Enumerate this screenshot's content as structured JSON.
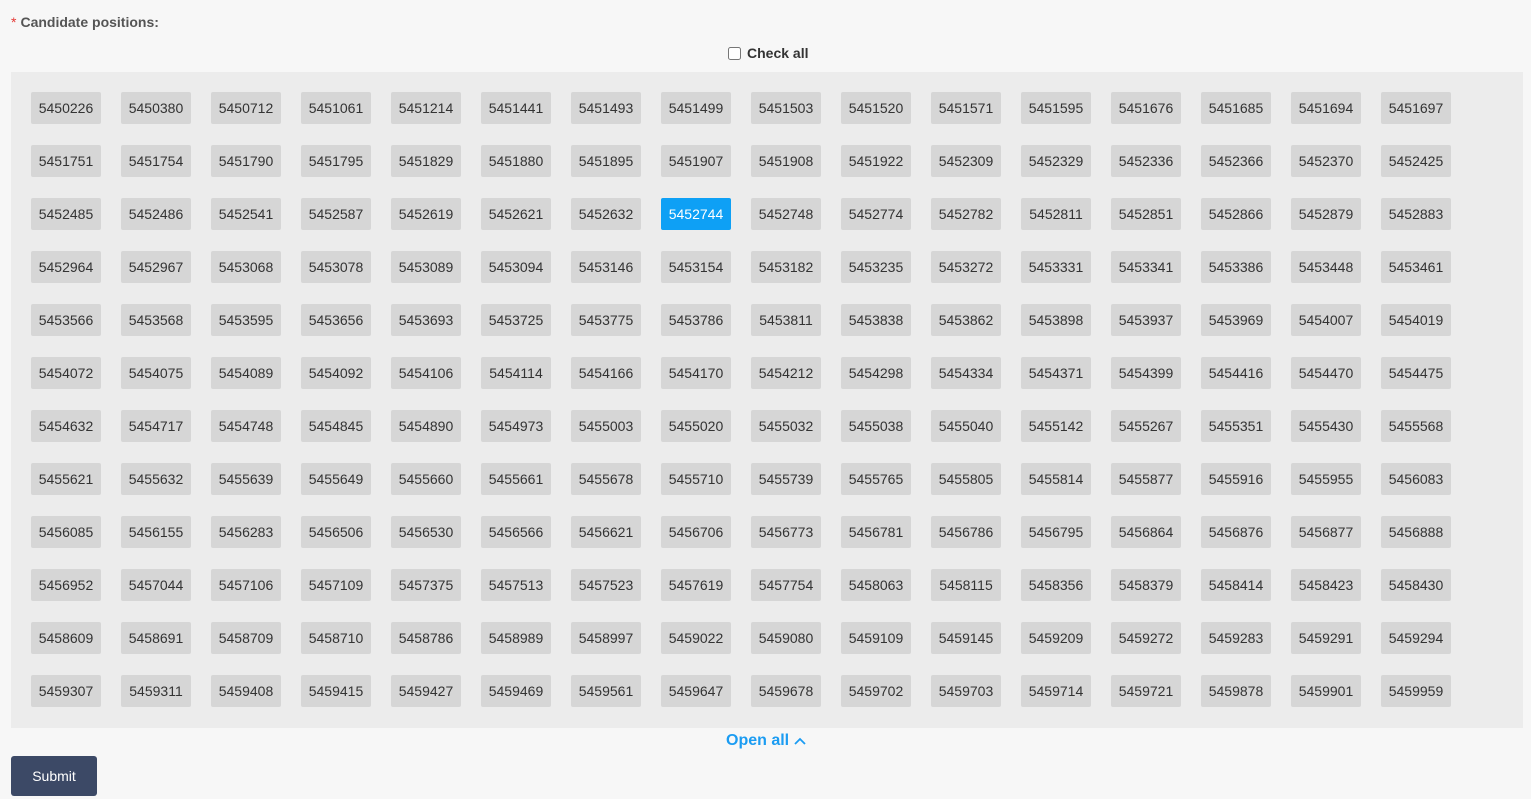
{
  "form": {
    "required_mark": "*",
    "label": "Candidate positions:",
    "check_all_label": "Check all",
    "open_all_label": "Open all",
    "submit_label": "Submit",
    "selected": "5452744",
    "positions": [
      "5450226",
      "5450380",
      "5450712",
      "5451061",
      "5451214",
      "5451441",
      "5451493",
      "5451499",
      "5451503",
      "5451520",
      "5451571",
      "5451595",
      "5451676",
      "5451685",
      "5451694",
      "5451697",
      "5451751",
      "5451754",
      "5451790",
      "5451795",
      "5451829",
      "5451880",
      "5451895",
      "5451907",
      "5451908",
      "5451922",
      "5452309",
      "5452329",
      "5452336",
      "5452366",
      "5452370",
      "5452425",
      "5452485",
      "5452486",
      "5452541",
      "5452587",
      "5452619",
      "5452621",
      "5452632",
      "5452744",
      "5452748",
      "5452774",
      "5452782",
      "5452811",
      "5452851",
      "5452866",
      "5452879",
      "5452883",
      "5452964",
      "5452967",
      "5453068",
      "5453078",
      "5453089",
      "5453094",
      "5453146",
      "5453154",
      "5453182",
      "5453235",
      "5453272",
      "5453331",
      "5453341",
      "5453386",
      "5453448",
      "5453461",
      "5453566",
      "5453568",
      "5453595",
      "5453656",
      "5453693",
      "5453725",
      "5453775",
      "5453786",
      "5453811",
      "5453838",
      "5453862",
      "5453898",
      "5453937",
      "5453969",
      "5454007",
      "5454019",
      "5454072",
      "5454075",
      "5454089",
      "5454092",
      "5454106",
      "5454114",
      "5454166",
      "5454170",
      "5454212",
      "5454298",
      "5454334",
      "5454371",
      "5454399",
      "5454416",
      "5454470",
      "5454475",
      "5454632",
      "5454717",
      "5454748",
      "5454845",
      "5454890",
      "5454973",
      "5455003",
      "5455020",
      "5455032",
      "5455038",
      "5455040",
      "5455142",
      "5455267",
      "5455351",
      "5455430",
      "5455568",
      "5455621",
      "5455632",
      "5455639",
      "5455649",
      "5455660",
      "5455661",
      "5455678",
      "5455710",
      "5455739",
      "5455765",
      "5455805",
      "5455814",
      "5455877",
      "5455916",
      "5455955",
      "5456083",
      "5456085",
      "5456155",
      "5456283",
      "5456506",
      "5456530",
      "5456566",
      "5456621",
      "5456706",
      "5456773",
      "5456781",
      "5456786",
      "5456795",
      "5456864",
      "5456876",
      "5456877",
      "5456888",
      "5456952",
      "5457044",
      "5457106",
      "5457109",
      "5457375",
      "5457513",
      "5457523",
      "5457619",
      "5457754",
      "5458063",
      "5458115",
      "5458356",
      "5458379",
      "5458414",
      "5458423",
      "5458430",
      "5458609",
      "5458691",
      "5458709",
      "5458710",
      "5458786",
      "5458989",
      "5458997",
      "5459022",
      "5459080",
      "5459109",
      "5459145",
      "5459209",
      "5459272",
      "5459283",
      "5459291",
      "5459294",
      "5459307",
      "5459311",
      "5459408",
      "5459415",
      "5459427",
      "5459469",
      "5459561",
      "5459647",
      "5459678",
      "5459702",
      "5459703",
      "5459714",
      "5459721",
      "5459878",
      "5459901",
      "5459959"
    ]
  },
  "colors": {
    "chip_bg": "#d6d6d6",
    "chip_selected_bg": "#0ea0f5",
    "link": "#1b9cf2",
    "submit_bg": "#3c4966",
    "required": "#e53935"
  },
  "icons": {
    "open_all": "chevron-up-icon"
  }
}
